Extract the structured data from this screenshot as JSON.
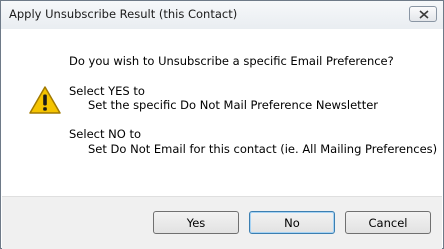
{
  "window": {
    "title": "Apply Unsubscribe Result (this Contact)"
  },
  "icons": {
    "close": "close-icon",
    "warning": "warning-icon"
  },
  "message": {
    "question": "Do you wish to Unsubscribe a specific Email Preference?",
    "yes_heading": "Select YES to",
    "yes_detail": "Set the specific Do Not Mail Preference Newsletter",
    "no_heading": "Select NO to",
    "no_detail": "Set Do Not Email for this contact (ie. All Mailing Preferences)"
  },
  "buttons": {
    "yes": "Yes",
    "no": "No",
    "cancel": "Cancel"
  },
  "colors": {
    "warning_fill": "#f5c400",
    "warning_border": "#a27a00",
    "default_button_border": "#3c7fb1"
  }
}
